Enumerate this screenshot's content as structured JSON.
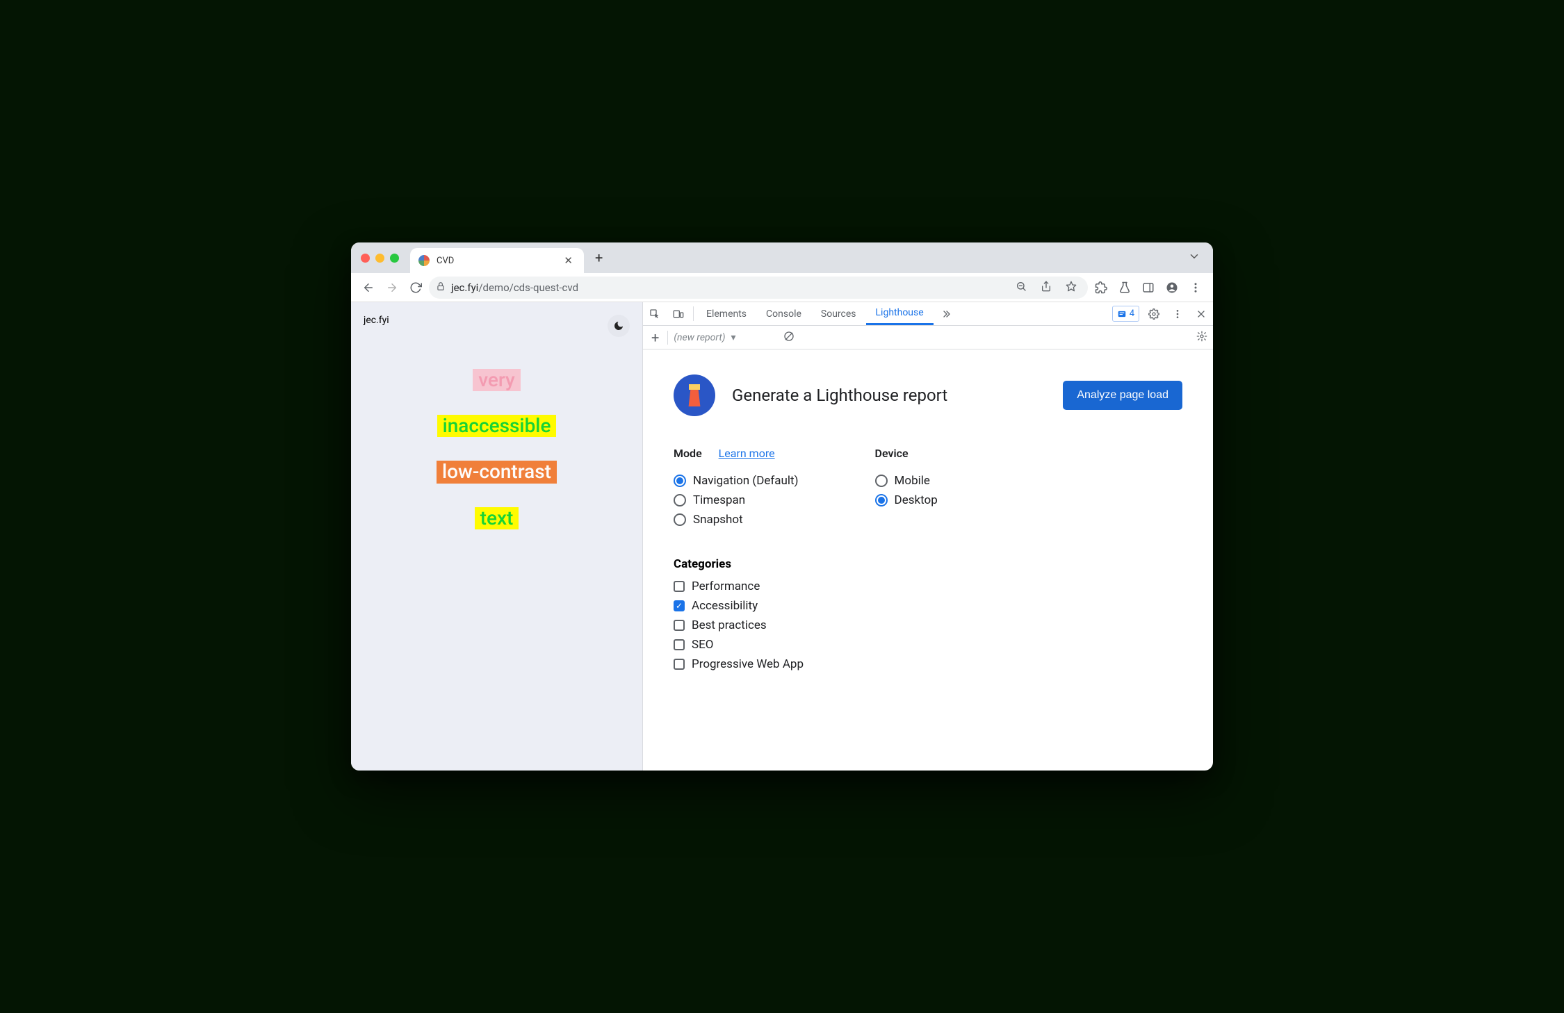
{
  "browser": {
    "tab_title": "CVD",
    "url_host": "jec.fyi",
    "url_path": "/demo/cds-quest-cvd"
  },
  "page": {
    "brand": "jec.fyi",
    "words": [
      {
        "text": "very",
        "fg": "#f39bb1",
        "bg": "#f7c4d0"
      },
      {
        "text": "inaccessible",
        "fg": "#17d335",
        "bg": "#fffb00"
      },
      {
        "text": "low-contrast",
        "fg": "#fdfdfd",
        "bg": "#f07f3a"
      },
      {
        "text": "text",
        "fg": "#17d335",
        "bg": "#fffb00"
      }
    ]
  },
  "devtools": {
    "tabs": [
      "Elements",
      "Console",
      "Sources",
      "Lighthouse"
    ],
    "active_tab": "Lighthouse",
    "issues_count": "4",
    "sub_report_label": "(new report)"
  },
  "lighthouse": {
    "title": "Generate a Lighthouse report",
    "cta": "Analyze page load",
    "mode_label": "Mode",
    "learn_more": "Learn more",
    "modes": [
      {
        "label": "Navigation (Default)",
        "selected": true
      },
      {
        "label": "Timespan",
        "selected": false
      },
      {
        "label": "Snapshot",
        "selected": false
      }
    ],
    "device_label": "Device",
    "devices": [
      {
        "label": "Mobile",
        "selected": false
      },
      {
        "label": "Desktop",
        "selected": true
      }
    ],
    "categories_label": "Categories",
    "categories": [
      {
        "label": "Performance",
        "checked": false
      },
      {
        "label": "Accessibility",
        "checked": true
      },
      {
        "label": "Best practices",
        "checked": false
      },
      {
        "label": "SEO",
        "checked": false
      },
      {
        "label": "Progressive Web App",
        "checked": false
      }
    ]
  }
}
